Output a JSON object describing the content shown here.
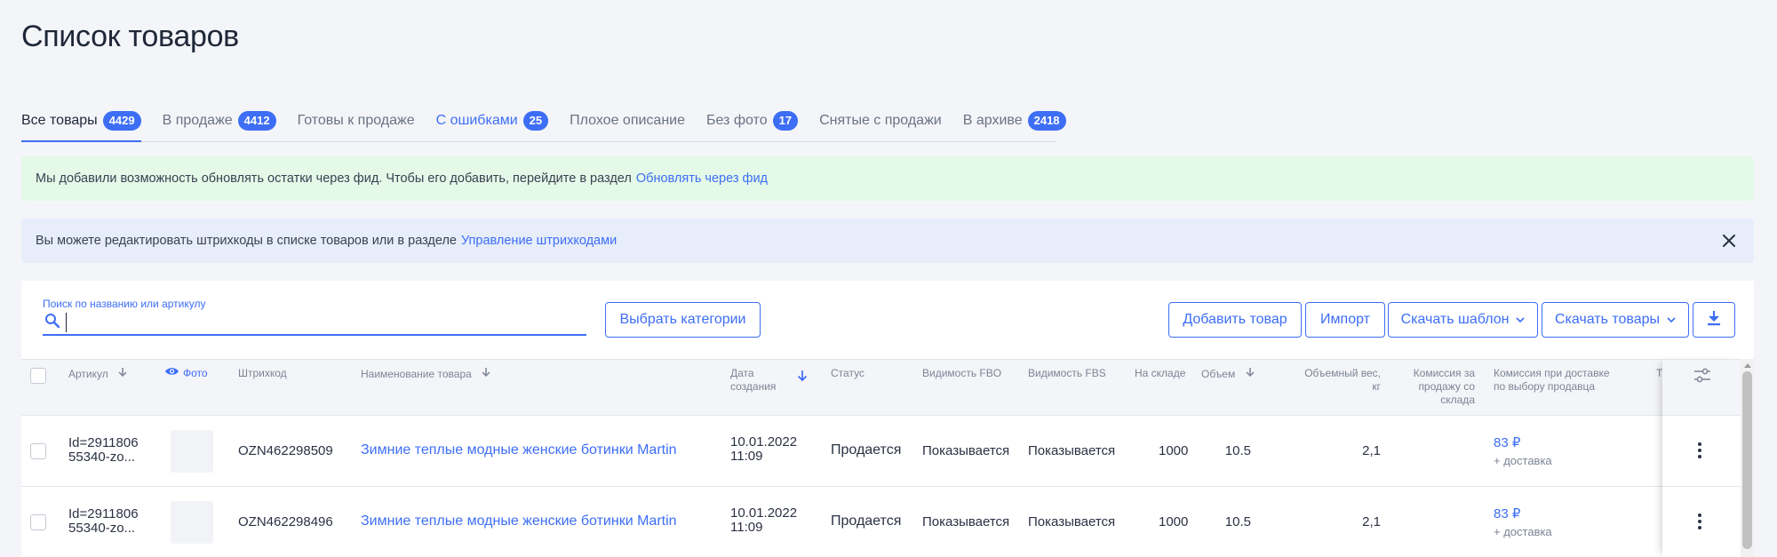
{
  "page": {
    "title": "Список товаров"
  },
  "tabs": [
    {
      "label": "Все товары",
      "count": "4429"
    },
    {
      "label": "В продаже",
      "count": "4412"
    },
    {
      "label": "Готовы к продаже",
      "count": ""
    },
    {
      "label": "С ошибками",
      "count": "25"
    },
    {
      "label": "Плохое описание",
      "count": ""
    },
    {
      "label": "Без фото",
      "count": "17"
    },
    {
      "label": "Снятые с продажи",
      "count": ""
    },
    {
      "label": "В архиве",
      "count": "2418"
    }
  ],
  "banners": {
    "feed": {
      "text": "Мы добавили возможность обновлять остатки через фид. Чтобы его добавить, перейдите в раздел",
      "link": "Обновлять через фид"
    },
    "barcodes": {
      "text": "Вы можете редактировать штрихкоды в списке товаров или в разделе",
      "link": "Управление штрихкодами"
    }
  },
  "toolbar": {
    "search_label": "Поиск по названию или артикулу",
    "search_value": "",
    "select_categories": "Выбрать категории",
    "add_product": "Добавить товар",
    "import": "Импорт",
    "download_template": "Скачать шаблон",
    "download_products": "Скачать товары"
  },
  "table": {
    "columns": {
      "article": "Артикул",
      "photo": "Фото",
      "barcode": "Штрихкод",
      "name": "Наименование товара",
      "created_1": "Дата",
      "created_2": "создания",
      "status": "Статус",
      "fbo": "Видимость FBO",
      "fbs": "Видимость FBS",
      "stock": "На складе",
      "volume": "Объем",
      "vol_weight_1": "Объемный вес,",
      "vol_weight_2": "кг",
      "commission_1": "Комиссия за",
      "commission_2": "продажу со",
      "commission_3": "склада",
      "seller_delivery_1": "Комиссия при доставке",
      "seller_delivery_2": "по выбору продавца",
      "truncated": "Т"
    },
    "rows": [
      {
        "article_1": "Id=2911806",
        "article_2": "55340-zo...",
        "barcode": "OZN462298509",
        "name": "Зимние теплые модные женские ботинки Martin",
        "date": "10.01.2022",
        "time": "11:09",
        "status": "Продается",
        "fbo": "Показывается",
        "fbs": "Показывается",
        "stock": "1000",
        "volume": "10.5",
        "vol_weight": "2,1",
        "price": "83 ₽",
        "price_note": "+ доставка"
      },
      {
        "article_1": "Id=2911806",
        "article_2": "55340-zo...",
        "barcode": "OZN462298496",
        "name": "Зимние теплые модные женские ботинки Martin",
        "date": "10.01.2022",
        "time": "11:09",
        "status": "Продается",
        "fbo": "Показывается",
        "fbs": "Показывается",
        "stock": "1000",
        "volume": "10.5",
        "vol_weight": "2,1",
        "price": "83 ₽",
        "price_note": "+ доставка"
      }
    ]
  },
  "colors": {
    "accent": "#3d6ef5",
    "success_bg": "#e4f9e8",
    "info_bg": "#e7edfb",
    "page_bg": "#f4f5f9"
  }
}
